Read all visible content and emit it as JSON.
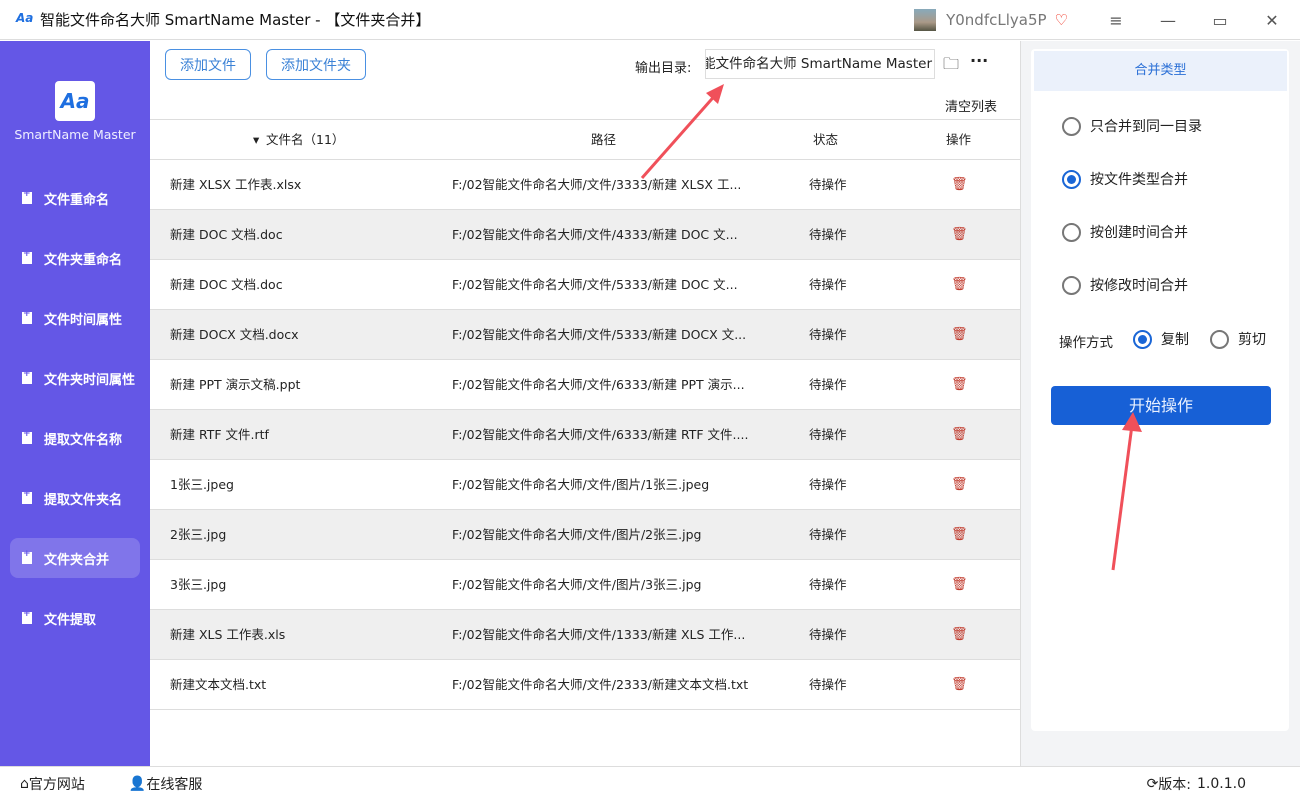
{
  "window": {
    "title": "智能文件命名大师 SmartName Master - 【文件夹合并】",
    "username": "Y0ndfcLlya5P"
  },
  "sidebar": {
    "app_name": "SmartName Master",
    "items": [
      {
        "label": "文件重命名"
      },
      {
        "label": "文件夹重命名"
      },
      {
        "label": "文件时间属性"
      },
      {
        "label": "文件夹时间属性"
      },
      {
        "label": "提取文件名称"
      },
      {
        "label": "提取文件夹名"
      },
      {
        "label": "文件夹合并",
        "active": true
      },
      {
        "label": "文件提取"
      }
    ]
  },
  "toolbar": {
    "add_file": "添加文件",
    "add_folder": "添加文件夹",
    "output_label": "输出目录:",
    "output_value": "智能文件命名大师 SmartName Master",
    "clear_list": "清空列表"
  },
  "table": {
    "headers": {
      "name": "文件名（11）",
      "path": "路径",
      "status": "状态",
      "action": "操作"
    },
    "rows": [
      {
        "name": "新建 XLSX 工作表.xlsx",
        "path": "F:/02智能文件命名大师/文件/3333/新建 XLSX 工...",
        "status": "待操作"
      },
      {
        "name": "新建 DOC 文档.doc",
        "path": "F:/02智能文件命名大师/文件/4333/新建 DOC 文...",
        "status": "待操作"
      },
      {
        "name": "新建 DOC 文档.doc",
        "path": "F:/02智能文件命名大师/文件/5333/新建 DOC 文...",
        "status": "待操作"
      },
      {
        "name": "新建 DOCX 文档.docx",
        "path": "F:/02智能文件命名大师/文件/5333/新建 DOCX 文...",
        "status": "待操作"
      },
      {
        "name": "新建 PPT 演示文稿.ppt",
        "path": "F:/02智能文件命名大师/文件/6333/新建 PPT 演示...",
        "status": "待操作"
      },
      {
        "name": "新建 RTF 文件.rtf",
        "path": "F:/02智能文件命名大师/文件/6333/新建 RTF 文件....",
        "status": "待操作"
      },
      {
        "name": "1张三.jpeg",
        "path": "F:/02智能文件命名大师/文件/图片/1张三.jpeg",
        "status": "待操作"
      },
      {
        "name": "2张三.jpg",
        "path": "F:/02智能文件命名大师/文件/图片/2张三.jpg",
        "status": "待操作"
      },
      {
        "name": "3张三.jpg",
        "path": "F:/02智能文件命名大师/文件/图片/3张三.jpg",
        "status": "待操作"
      },
      {
        "name": "新建 XLS 工作表.xls",
        "path": "F:/02智能文件命名大师/文件/1333/新建 XLS 工作...",
        "status": "待操作"
      },
      {
        "name": "新建文本文档.txt",
        "path": "F:/02智能文件命名大师/文件/2333/新建文本文档.txt",
        "status": "待操作"
      }
    ]
  },
  "panel": {
    "title": "合并类型",
    "options": [
      {
        "label": "只合并到同一目录",
        "selected": false
      },
      {
        "label": "按文件类型合并",
        "selected": true
      },
      {
        "label": "按创建时间合并",
        "selected": false
      },
      {
        "label": "按修改时间合并",
        "selected": false
      }
    ],
    "mode_label": "操作方式",
    "modes": [
      {
        "label": "复制",
        "selected": true
      },
      {
        "label": "剪切",
        "selected": false
      }
    ],
    "start": "开始操作"
  },
  "footer": {
    "website": "官方网站",
    "support": "在线客服",
    "version_label": "版本:",
    "version": "1.0.1.0"
  },
  "colors": {
    "sidebar": "#6457e6",
    "primary": "#1760d6",
    "arrow": "#f0505a"
  }
}
